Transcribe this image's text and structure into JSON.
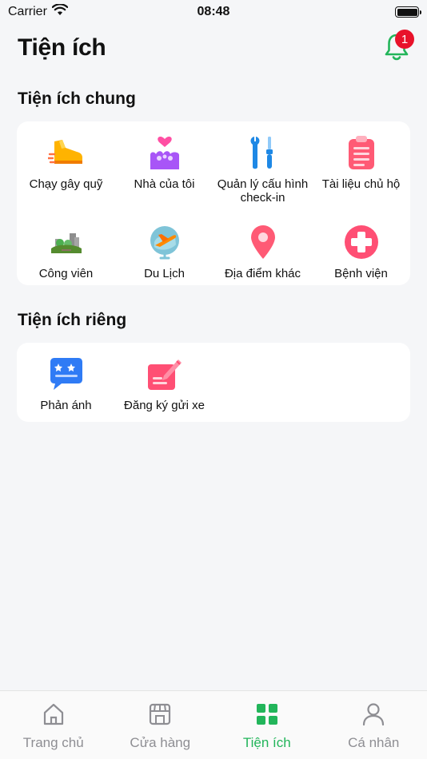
{
  "status": {
    "carrier": "Carrier",
    "time": "08:48"
  },
  "header": {
    "title": "Tiện ích",
    "notification_count": "1"
  },
  "common": {
    "title": "Tiện ích chung",
    "items": [
      {
        "label": "Chạy gây quỹ",
        "icon": "running-shoe-icon"
      },
      {
        "label": "Nhà của tôi",
        "icon": "my-house-icon"
      },
      {
        "label": "Quản lý cấu hình check-in",
        "icon": "tools-icon"
      },
      {
        "label": "Tài liệu chủ hộ",
        "icon": "clipboard-icon"
      },
      {
        "label": "Công viên",
        "icon": "park-icon"
      },
      {
        "label": "Du Lịch",
        "icon": "airplane-globe-icon"
      },
      {
        "label": "Địa điểm khác",
        "icon": "location-pin-icon"
      },
      {
        "label": "Bệnh viện",
        "icon": "hospital-cross-icon"
      }
    ]
  },
  "private": {
    "title": "Tiện ích riêng",
    "items": [
      {
        "label": "Phản ánh",
        "icon": "feedback-chat-icon"
      },
      {
        "label": "Đăng ký gửi xe",
        "icon": "register-note-icon"
      }
    ]
  },
  "tabbar": {
    "items": [
      {
        "label": "Trang chủ",
        "icon": "home-icon"
      },
      {
        "label": "Cửa hàng",
        "icon": "store-icon"
      },
      {
        "label": "Tiện ích",
        "icon": "grid-icon"
      },
      {
        "label": "Cá nhân",
        "icon": "person-icon"
      }
    ],
    "active_color": "#22b55a",
    "inactive_color": "#8e8e93"
  }
}
